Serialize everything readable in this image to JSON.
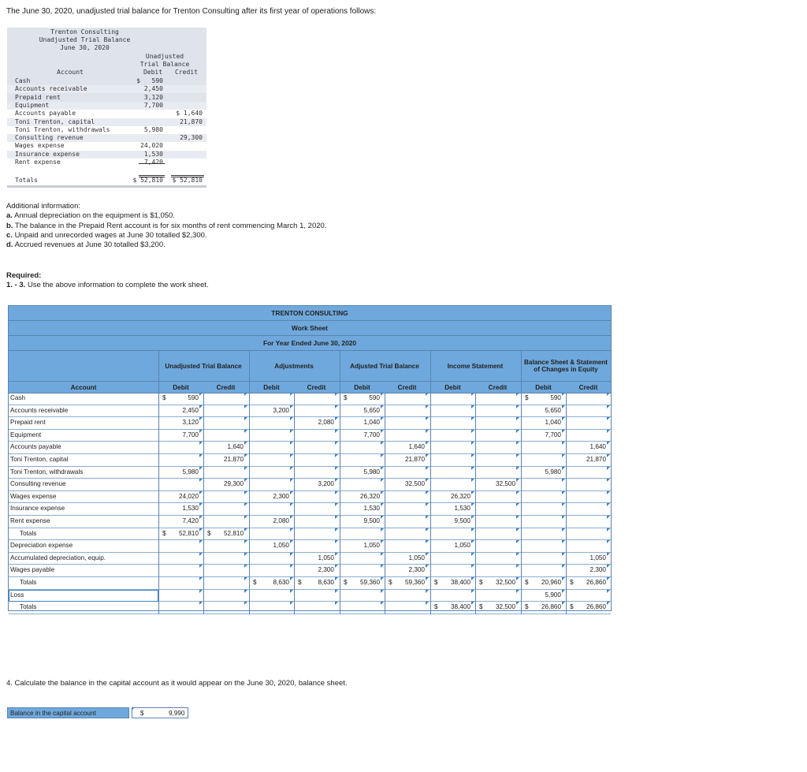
{
  "intro": "The June 30, 2020, unadjusted trial balance for Trenton Consulting after its first year of operations follows:",
  "trial_balance": {
    "company": "Trenton Consulting",
    "title": "Unadjusted Trial Balance",
    "date": "June 30, 2020",
    "col_group": [
      "Unadjusted",
      "Trial Balance"
    ],
    "h_account": "Account",
    "h_debit": "Debit",
    "h_credit": "Credit",
    "rows": [
      {
        "account": "Cash",
        "debit": "$   590",
        "credit": ""
      },
      {
        "account": "Accounts receivable",
        "debit": "2,450",
        "credit": ""
      },
      {
        "account": "Prepaid rent",
        "debit": "3,120",
        "credit": ""
      },
      {
        "account": "Equipment",
        "debit": "7,700",
        "credit": ""
      },
      {
        "account": "Accounts payable",
        "debit": "",
        "credit": "$ 1,640"
      },
      {
        "account": "Toni Trenton, capital",
        "debit": "",
        "credit": "21,870"
      },
      {
        "account": "Toni Trenton, withdrawals",
        "debit": "5,980",
        "credit": ""
      },
      {
        "account": "Consulting revenue",
        "debit": "",
        "credit": "29,300"
      },
      {
        "account": "Wages expense",
        "debit": "24,020",
        "credit": ""
      },
      {
        "account": "Insurance expense",
        "debit": "1,530",
        "credit": ""
      },
      {
        "account": "Rent expense",
        "debit": "7,420",
        "credit": ""
      },
      {
        "account": "Totals",
        "debit": "$ 52,810",
        "credit": "$ 52,810"
      }
    ]
  },
  "additional": {
    "heading": "Additional information:",
    "items": [
      {
        "label": "a.",
        "text": "Annual depreciation on the equipment is $1,050."
      },
      {
        "label": "b.",
        "text": "The balance in the Prepaid Rent account is for six months of rent commencing March 1, 2020."
      },
      {
        "label": "c.",
        "text": "Unpaid and unrecorded wages at June 30 totalled $2,300."
      },
      {
        "label": "d.",
        "text": "Accrued revenues at June 30 totalled $3,200."
      }
    ]
  },
  "required": {
    "heading": "Required:",
    "label": "1. - 3.",
    "text": "Use the above information to complete the work sheet."
  },
  "worksheet": {
    "company": "TRENTON CONSULTING",
    "title": "Work Sheet",
    "period": "For Year Ended June 30, 2020",
    "groups": [
      "Unadjusted Trial Balance",
      "Adjustments",
      "Adjusted Trial Balance",
      "Income Statement",
      "Balance Sheet & Statement of Changes in Equity"
    ],
    "h_account": "Account",
    "h_debit": "Debit",
    "h_credit": "Credit",
    "currency": "$",
    "rows": [
      {
        "account": "Cash",
        "indent": false,
        "utb_d": "590",
        "utb_d_dollar": true,
        "utb_c": "",
        "adj_d": "",
        "adj_c": "",
        "atb_d": "590",
        "atb_d_dollar": true,
        "atb_c": "",
        "is_d": "",
        "is_c": "",
        "bs_d": "590",
        "bs_d_dollar": true,
        "bs_c": ""
      },
      {
        "account": "Accounts receivable",
        "indent": false,
        "utb_d": "2,450",
        "utb_c": "",
        "adj_d": "3,200",
        "adj_c": "",
        "atb_d": "5,650",
        "atb_c": "",
        "is_d": "",
        "is_c": "",
        "bs_d": "5,650",
        "bs_c": ""
      },
      {
        "account": "Prepaid rent",
        "indent": false,
        "utb_d": "3,120",
        "utb_c": "",
        "adj_d": "",
        "adj_c": "2,080",
        "atb_d": "1,040",
        "atb_c": "",
        "is_d": "",
        "is_c": "",
        "bs_d": "1,040",
        "bs_c": ""
      },
      {
        "account": "Equipment",
        "indent": false,
        "utb_d": "7,700",
        "utb_c": "",
        "adj_d": "",
        "adj_c": "",
        "atb_d": "7,700",
        "atb_c": "",
        "is_d": "",
        "is_c": "",
        "bs_d": "7,700",
        "bs_c": ""
      },
      {
        "account": "Accounts payable",
        "indent": false,
        "utb_d": "",
        "utb_c": "1,640",
        "adj_d": "",
        "adj_c": "",
        "atb_d": "",
        "atb_c": "1,640",
        "is_d": "",
        "is_c": "",
        "bs_d": "",
        "bs_c": "1,640"
      },
      {
        "account": "Toni Trenton, capital",
        "indent": false,
        "utb_d": "",
        "utb_c": "21,870",
        "adj_d": "",
        "adj_c": "",
        "atb_d": "",
        "atb_c": "21,870",
        "is_d": "",
        "is_c": "",
        "bs_d": "",
        "bs_c": "21,870"
      },
      {
        "account": "Toni Trenton, withdrawals",
        "indent": false,
        "utb_d": "5,980",
        "utb_c": "",
        "adj_d": "",
        "adj_c": "",
        "atb_d": "5,980",
        "atb_c": "",
        "is_d": "",
        "is_c": "",
        "bs_d": "5,980",
        "bs_c": ""
      },
      {
        "account": "Consulting revenue",
        "indent": false,
        "utb_d": "",
        "utb_c": "29,300",
        "adj_d": "",
        "adj_c": "3,200",
        "atb_d": "",
        "atb_c": "32,500",
        "is_d": "",
        "is_c": "32,500",
        "bs_d": "",
        "bs_c": ""
      },
      {
        "account": "Wages expense",
        "indent": false,
        "utb_d": "24,020",
        "utb_c": "",
        "adj_d": "2,300",
        "adj_c": "",
        "atb_d": "26,320",
        "atb_c": "",
        "is_d": "26,320",
        "is_c": "",
        "bs_d": "",
        "bs_c": ""
      },
      {
        "account": "Insurance expense",
        "indent": false,
        "utb_d": "1,530",
        "utb_c": "",
        "adj_d": "",
        "adj_c": "",
        "atb_d": "1,530",
        "atb_c": "",
        "is_d": "1,530",
        "is_c": "",
        "bs_d": "",
        "bs_c": ""
      },
      {
        "account": "Rent expense",
        "indent": false,
        "utb_d": "7,420",
        "utb_c": "",
        "adj_d": "2,080",
        "adj_c": "",
        "atb_d": "9,500",
        "atb_c": "",
        "is_d": "9,500",
        "is_c": "",
        "bs_d": "",
        "bs_c": ""
      },
      {
        "account": "Totals",
        "indent": true,
        "utb_d": "52,810",
        "utb_d_dollar": true,
        "utb_c": "52,810",
        "utb_c_dollar": true,
        "adj_d": "",
        "adj_c": "",
        "atb_d": "",
        "atb_c": "",
        "is_d": "",
        "is_c": "",
        "bs_d": "",
        "bs_c": ""
      },
      {
        "account": "Depreciation expense",
        "indent": false,
        "utb_d": "",
        "utb_c": "",
        "adj_d": "1,050",
        "adj_c": "",
        "atb_d": "1,050",
        "atb_c": "",
        "is_d": "1,050",
        "is_c": "",
        "bs_d": "",
        "bs_c": ""
      },
      {
        "account": "Accumulated depreciation, equip.",
        "indent": false,
        "utb_d": "",
        "utb_c": "",
        "adj_d": "",
        "adj_c": "1,050",
        "atb_d": "",
        "atb_c": "1,050",
        "is_d": "",
        "is_c": "",
        "bs_d": "",
        "bs_c": "1,050"
      },
      {
        "account": "Wages payable",
        "indent": false,
        "utb_d": "",
        "utb_c": "",
        "adj_d": "",
        "adj_c": "2,300",
        "atb_d": "",
        "atb_c": "2,300",
        "is_d": "",
        "is_c": "",
        "bs_d": "",
        "bs_c": "2,300"
      },
      {
        "account": "Totals",
        "indent": true,
        "utb_d": "",
        "utb_c": "",
        "adj_d": "8,630",
        "adj_d_dollar": true,
        "adj_c": "8,630",
        "adj_c_dollar": true,
        "atb_d": "59,360",
        "atb_d_dollar": true,
        "atb_c": "59,360",
        "atb_c_dollar": true,
        "is_d": "38,400",
        "is_d_dollar": true,
        "is_c": "32,500",
        "is_c_dollar": true,
        "bs_d": "20,960",
        "bs_d_dollar": true,
        "bs_c": "26,860",
        "bs_c_dollar": true
      },
      {
        "account": "Loss",
        "indent": false,
        "input": true,
        "utb_d": "",
        "utb_c": "",
        "adj_d": "",
        "adj_c": "",
        "atb_d": "",
        "atb_c": "",
        "is_d": "",
        "is_c": "",
        "bs_d": "5,900",
        "bs_c": ""
      },
      {
        "account": "Totals",
        "indent": true,
        "utb_d": "",
        "utb_c": "",
        "adj_d": "",
        "adj_c": "",
        "atb_d": "",
        "atb_c": "",
        "is_d": "38,400",
        "is_d_dollar": true,
        "is_c": "32,500",
        "is_c_dollar": true,
        "bs_d": "26,860",
        "bs_d_dollar": true,
        "bs_c": "26,860",
        "bs_c_dollar": true
      }
    ]
  },
  "question4": {
    "text": "4. Calculate the balance in the capital account as it would appear on the June 30, 2020, balance sheet.",
    "label": "Balance in the capital account",
    "currency": "$",
    "value": "9,990"
  }
}
